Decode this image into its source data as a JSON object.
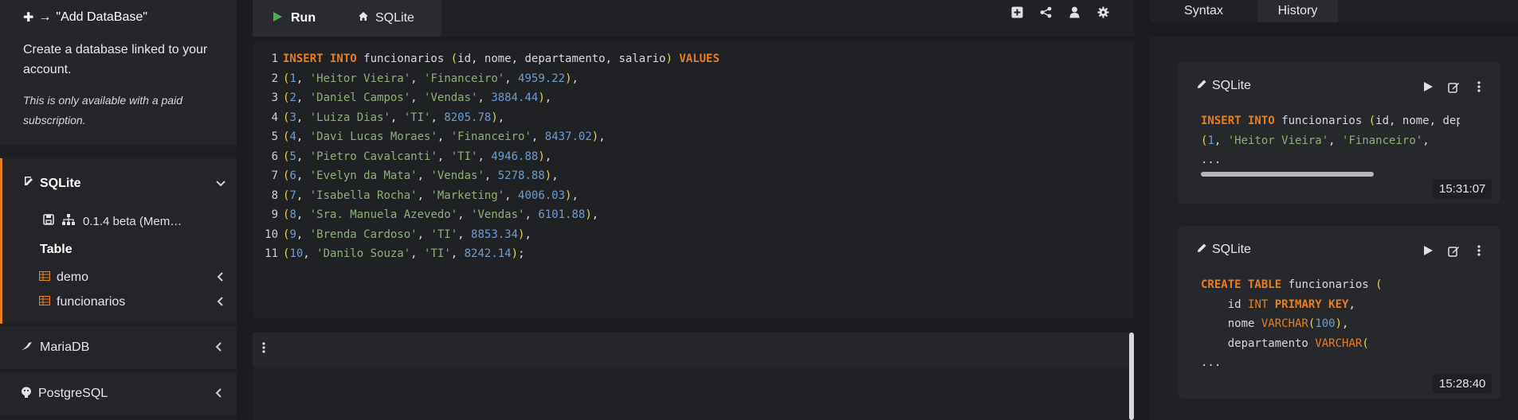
{
  "sidebar": {
    "promo": {
      "header": "\"Add DataBase\"",
      "description": "Create a database linked to your account.",
      "note": "This is only available with a paid subscription."
    },
    "active_db": {
      "name": "SQLite",
      "connection": "0.1.4 beta (Mem…",
      "table_section_label": "Table",
      "tables": [
        "demo",
        "funcionarios"
      ]
    },
    "other_dbs": [
      "MariaDB",
      "PostgreSQL"
    ]
  },
  "toolbar": {
    "run_label": "Run",
    "db_tab_label": "SQLite",
    "icons": [
      "add-square-icon",
      "share-icon",
      "user-icon",
      "gear-icon"
    ]
  },
  "editor": {
    "lines": [
      {
        "n": "1",
        "tokens": [
          [
            "kw",
            "INSERT INTO"
          ],
          [
            "pl",
            " funcionarios "
          ],
          [
            "pn",
            "("
          ],
          [
            "pl",
            "id, nome, departamento, salario"
          ],
          [
            "pn",
            ")"
          ],
          [
            "pl",
            " "
          ],
          [
            "kw",
            "VALUES"
          ]
        ]
      },
      {
        "n": "2",
        "tokens": [
          [
            "pn",
            "("
          ],
          [
            "num",
            "1"
          ],
          [
            "pl",
            ", "
          ],
          [
            "str",
            "'Heitor Vieira'"
          ],
          [
            "pl",
            ", "
          ],
          [
            "str",
            "'Financeiro'"
          ],
          [
            "pl",
            ", "
          ],
          [
            "num",
            "4959.22"
          ],
          [
            "pn",
            ")"
          ],
          [
            "pl",
            ","
          ]
        ]
      },
      {
        "n": "3",
        "tokens": [
          [
            "pn",
            "("
          ],
          [
            "num",
            "2"
          ],
          [
            "pl",
            ", "
          ],
          [
            "str",
            "'Daniel Campos'"
          ],
          [
            "pl",
            ", "
          ],
          [
            "str",
            "'Vendas'"
          ],
          [
            "pl",
            ", "
          ],
          [
            "num",
            "3884.44"
          ],
          [
            "pn",
            ")"
          ],
          [
            "pl",
            ","
          ]
        ]
      },
      {
        "n": "4",
        "tokens": [
          [
            "pn",
            "("
          ],
          [
            "num",
            "3"
          ],
          [
            "pl",
            ", "
          ],
          [
            "str",
            "'Luiza Dias'"
          ],
          [
            "pl",
            ", "
          ],
          [
            "str",
            "'TI'"
          ],
          [
            "pl",
            ", "
          ],
          [
            "num",
            "8205.78"
          ],
          [
            "pn",
            ")"
          ],
          [
            "pl",
            ","
          ]
        ]
      },
      {
        "n": "5",
        "tokens": [
          [
            "pn",
            "("
          ],
          [
            "num",
            "4"
          ],
          [
            "pl",
            ", "
          ],
          [
            "str",
            "'Davi Lucas Moraes'"
          ],
          [
            "pl",
            ", "
          ],
          [
            "str",
            "'Financeiro'"
          ],
          [
            "pl",
            ", "
          ],
          [
            "num",
            "8437.02"
          ],
          [
            "pn",
            ")"
          ],
          [
            "pl",
            ","
          ]
        ]
      },
      {
        "n": "6",
        "tokens": [
          [
            "pn",
            "("
          ],
          [
            "num",
            "5"
          ],
          [
            "pl",
            ", "
          ],
          [
            "str",
            "'Pietro Cavalcanti'"
          ],
          [
            "pl",
            ", "
          ],
          [
            "str",
            "'TI'"
          ],
          [
            "pl",
            ", "
          ],
          [
            "num",
            "4946.88"
          ],
          [
            "pn",
            ")"
          ],
          [
            "pl",
            ","
          ]
        ]
      },
      {
        "n": "7",
        "tokens": [
          [
            "pn",
            "("
          ],
          [
            "num",
            "6"
          ],
          [
            "pl",
            ", "
          ],
          [
            "str",
            "'Evelyn da Mata'"
          ],
          [
            "pl",
            ", "
          ],
          [
            "str",
            "'Vendas'"
          ],
          [
            "pl",
            ", "
          ],
          [
            "num",
            "5278.88"
          ],
          [
            "pn",
            ")"
          ],
          [
            "pl",
            ","
          ]
        ]
      },
      {
        "n": "8",
        "tokens": [
          [
            "pn",
            "("
          ],
          [
            "num",
            "7"
          ],
          [
            "pl",
            ", "
          ],
          [
            "str",
            "'Isabella Rocha'"
          ],
          [
            "pl",
            ", "
          ],
          [
            "str",
            "'Marketing'"
          ],
          [
            "pl",
            ", "
          ],
          [
            "num",
            "4006.03"
          ],
          [
            "pn",
            ")"
          ],
          [
            "pl",
            ","
          ]
        ]
      },
      {
        "n": "9",
        "tokens": [
          [
            "pn",
            "("
          ],
          [
            "num",
            "8"
          ],
          [
            "pl",
            ", "
          ],
          [
            "str",
            "'Sra. Manuela Azevedo'"
          ],
          [
            "pl",
            ", "
          ],
          [
            "str",
            "'Vendas'"
          ],
          [
            "pl",
            ", "
          ],
          [
            "num",
            "6101.88"
          ],
          [
            "pn",
            ")"
          ],
          [
            "pl",
            ","
          ]
        ]
      },
      {
        "n": "10",
        "tokens": [
          [
            "pn",
            "("
          ],
          [
            "num",
            "9"
          ],
          [
            "pl",
            ", "
          ],
          [
            "str",
            "'Brenda Cardoso'"
          ],
          [
            "pl",
            ", "
          ],
          [
            "str",
            "'TI'"
          ],
          [
            "pl",
            ", "
          ],
          [
            "num",
            "8853.34"
          ],
          [
            "pn",
            ")"
          ],
          [
            "pl",
            ","
          ]
        ]
      },
      {
        "n": "11",
        "tokens": [
          [
            "pn",
            "("
          ],
          [
            "num",
            "10"
          ],
          [
            "pl",
            ", "
          ],
          [
            "str",
            "'Danilo Souza'"
          ],
          [
            "pl",
            ", "
          ],
          [
            "str",
            "'TI'"
          ],
          [
            "pl",
            ", "
          ],
          [
            "num",
            "8242.14"
          ],
          [
            "pn",
            ")"
          ],
          [
            "pl",
            ";"
          ]
        ]
      }
    ]
  },
  "right_panel": {
    "tabs": [
      "Syntax",
      "History"
    ],
    "history": [
      {
        "title": "SQLite",
        "time": "15:31:07",
        "lines": [
          [
            [
              "kw",
              "INSERT INTO"
            ],
            [
              "pl",
              " funcionarios "
            ],
            [
              "pn",
              "("
            ],
            [
              "pl",
              "id, nome, depa"
            ]
          ],
          [
            [
              "pn",
              "("
            ],
            [
              "num",
              "1"
            ],
            [
              "pl",
              ", "
            ],
            [
              "str",
              "'Heitor Vieira'"
            ],
            [
              "pl",
              ", "
            ],
            [
              "str",
              "'Financeiro'"
            ],
            [
              "pl",
              ","
            ]
          ],
          [
            [
              "pl",
              "..."
            ]
          ]
        ]
      },
      {
        "title": "SQLite",
        "time": "15:28:40",
        "lines": [
          [
            [
              "kw",
              "CREATE TABLE"
            ],
            [
              "pl",
              " funcionarios "
            ],
            [
              "pn",
              "("
            ]
          ],
          [
            [
              "pl",
              "    id "
            ],
            [
              "str2",
              "INT "
            ],
            [
              "kw",
              "PRIMARY KEY"
            ],
            [
              "pl",
              ","
            ]
          ],
          [
            [
              "pl",
              "    nome "
            ],
            [
              "str2",
              "VARCHAR"
            ],
            [
              "pn",
              "("
            ],
            [
              "num",
              "100"
            ],
            [
              "pn",
              ")"
            ],
            [
              "pl",
              ","
            ]
          ],
          [
            [
              "pl",
              "    departamento "
            ],
            [
              "str2",
              "VARCHAR"
            ],
            [
              "pn",
              "("
            ]
          ],
          [
            [
              "pl",
              "..."
            ]
          ]
        ]
      }
    ]
  },
  "colors": {
    "accent": "#e67e22",
    "keyword": "#e67e22",
    "string": "#8fae79",
    "number": "#6f9ccd",
    "paren": "#e8d44d",
    "run_icon": "#4caf50"
  }
}
